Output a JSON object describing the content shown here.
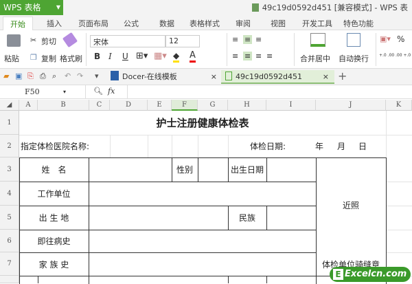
{
  "app": {
    "name": "WPS 表格",
    "title": "49c19d0592d451 [兼容模式] - WPS 表"
  },
  "tabs": [
    "开始",
    "插入",
    "页面布局",
    "公式",
    "数据",
    "表格样式",
    "审阅",
    "视图",
    "开发工具",
    "特色功能"
  ],
  "ribbon": {
    "paste": "粘贴",
    "cut": "剪切",
    "copy": "复制",
    "format_painter": "格式刷",
    "font": "宋体",
    "font_size": "12",
    "bold": "B",
    "italic": "I",
    "underline": "U",
    "merge_center": "合并居中",
    "wrap_text": "自动换行",
    "percent": "%",
    "dec_inc": "+.0 .00",
    "dec_dec": ".00 +.0"
  },
  "doc_tabs": {
    "docer": "Docer-在线模板",
    "file": "49c19d0592d451",
    "add": "+"
  },
  "formula_bar": {
    "cell_ref": "F50",
    "fx": "fx",
    "value": ""
  },
  "columns": [
    "A",
    "B",
    "C",
    "D",
    "E",
    "F",
    "G",
    "H",
    "I",
    "J",
    "K"
  ],
  "rows": [
    "1",
    "2",
    "3",
    "4",
    "5",
    "6",
    "7"
  ],
  "sheet": {
    "title": "护士注册健康体检表",
    "hospital_label": "指定体检医院名称:",
    "date_label": "体检日期:",
    "year": "年",
    "month": "月",
    "day": "日",
    "name": "姓　名",
    "gender": "性别",
    "birth_date": "出生日期",
    "workplace": "工作单位",
    "photo": "近照",
    "birthplace": "出 生 地",
    "ethnicity": "民族",
    "past_history": "即往病史",
    "family_history": "家 族 史",
    "stamp": "体检单位骑缝章"
  },
  "watermark": "Excelcn.com",
  "colors": {
    "accent": "#4ea533"
  }
}
